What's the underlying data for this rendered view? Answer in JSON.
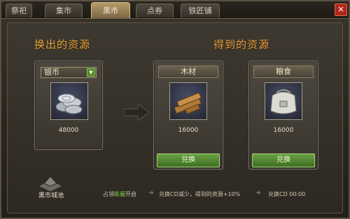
{
  "tabs": [
    {
      "label": "祭祀"
    },
    {
      "label": "集市"
    },
    {
      "label": "黑市",
      "active": true
    },
    {
      "label": "点券"
    },
    {
      "label": "铁匠铺"
    }
  ],
  "close_icon": "×",
  "give": {
    "heading": "换出的资源",
    "selected": "银币",
    "icon": "silver-coins-icon",
    "amount": "48000"
  },
  "receive": {
    "heading": "得到的资源",
    "items": [
      {
        "name": "木材",
        "icon": "wood-icon",
        "amount": "16000",
        "button": "兑换"
      },
      {
        "name": "粮食",
        "icon": "grain-sack-icon",
        "amount": "16000",
        "button": "兑换"
      }
    ]
  },
  "footer": {
    "building_label": "黑市城池",
    "occupy_prefix": "占领",
    "occupy_link": "陈留",
    "occupy_suffix": "开启",
    "effect": "兑换CD减少，得到的资源+10%",
    "cd_label": "兑换CD 00:00"
  },
  "colors": {
    "accent": "#e9a23b",
    "button": "#4f8a2a",
    "link": "#7fe04a"
  }
}
